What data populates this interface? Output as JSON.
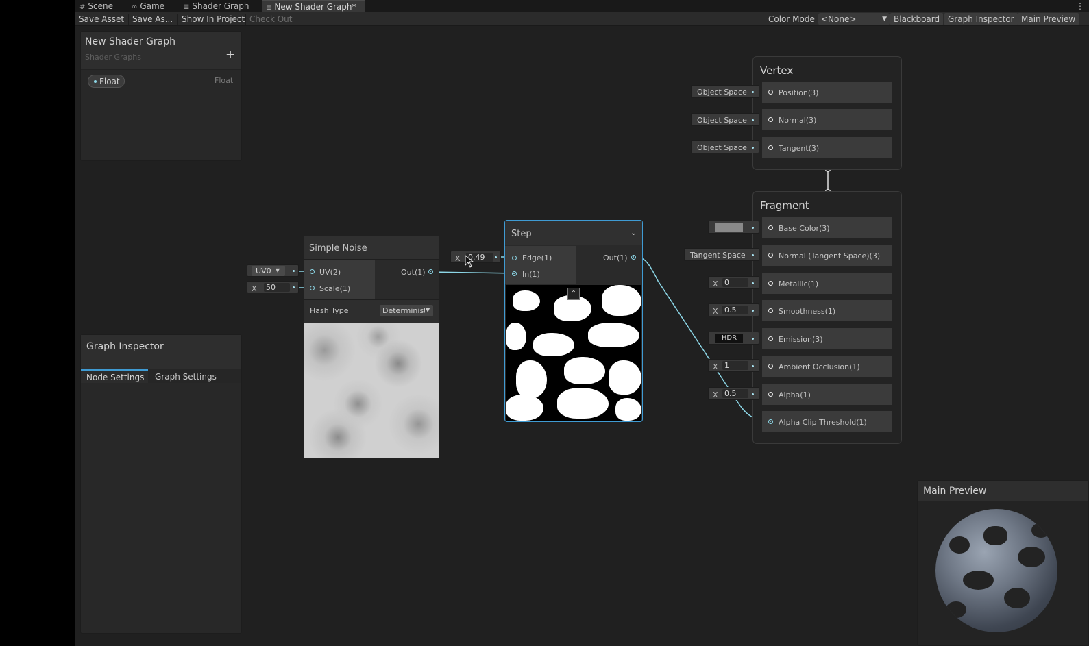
{
  "tabs": [
    {
      "icon": "#",
      "label": "Scene"
    },
    {
      "icon": "∞",
      "label": "Game"
    },
    {
      "icon": "≣",
      "label": "Shader Graph"
    },
    {
      "icon": "≣",
      "label": "New Shader Graph*"
    }
  ],
  "toolbar": {
    "save_asset": "Save Asset",
    "save_as": "Save As...",
    "show_in_project": "Show In Project",
    "check_out": "Check Out",
    "color_mode_label": "Color Mode",
    "color_mode_value": "<None>",
    "blackboard": "Blackboard",
    "graph_inspector": "Graph Inspector",
    "main_preview": "Main Preview",
    "more": "⋮"
  },
  "blackboard": {
    "title": "New Shader Graph",
    "subtitle": "Shader Graphs",
    "add": "+",
    "property_name": "Float",
    "property_type": "Float"
  },
  "inspector": {
    "title": "Graph Inspector",
    "tabs": [
      "Node Settings",
      "Graph Settings"
    ]
  },
  "simple_noise": {
    "title": "Simple Noise",
    "uv_label": "UV(2)",
    "scale_label": "Scale(1)",
    "out_label": "Out(1)",
    "uv_field": "UV0",
    "scale_x": "X",
    "scale_value": "50",
    "hash_label": "Hash Type",
    "hash_value": "Deterministi"
  },
  "step": {
    "title": "Step",
    "edge_label": "Edge(1)",
    "in_label": "In(1)",
    "out_label": "Out(1)",
    "edge_x": "X",
    "edge_value": "0.49"
  },
  "vertex": {
    "title": "Vertex",
    "rows": [
      {
        "label": "Position(3)",
        "field": "Object Space"
      },
      {
        "label": "Normal(3)",
        "field": "Object Space"
      },
      {
        "label": "Tangent(3)",
        "field": "Object Space"
      }
    ]
  },
  "fragment": {
    "title": "Fragment",
    "base_color": "Base Color(3)",
    "base_color_swatch": "#8a8a8a",
    "normal": "Normal (Tangent Space)(3)",
    "normal_field": "Tangent Space",
    "metallic": "Metallic(1)",
    "metallic_value": "0",
    "smoothness": "Smoothness(1)",
    "smoothness_value": "0.5",
    "emission": "Emission(3)",
    "emission_field": "HDR",
    "ao": "Ambient Occlusion(1)",
    "ao_value": "1",
    "alpha": "Alpha(1)",
    "alpha_value": "0.5",
    "alpha_clip": "Alpha Clip Threshold(1)",
    "x": "X"
  },
  "main_preview": {
    "title": "Main Preview"
  },
  "colors": {
    "wire": "#8cd6e6",
    "accent": "#3f9bd3"
  }
}
